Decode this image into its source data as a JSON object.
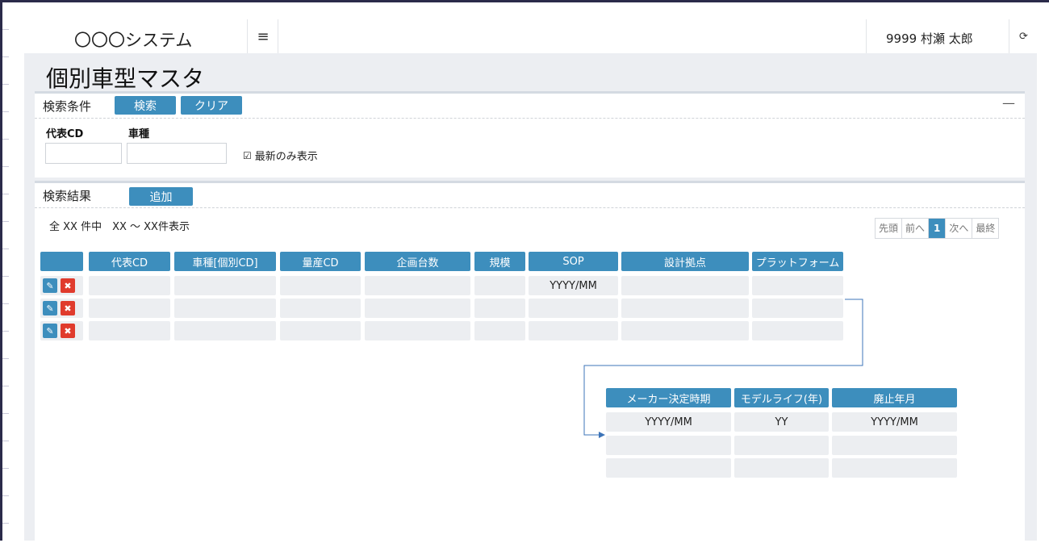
{
  "header": {
    "app_title": "〇〇〇システム",
    "menu_icon": "≡",
    "user_name": "9999 村瀬 太郎",
    "logout_icon": "⟳"
  },
  "page": {
    "title": "個別車型マスタ"
  },
  "search_panel": {
    "label": "検索条件",
    "search_button": "検索",
    "clear_button": "クリア",
    "collapse_icon": "—",
    "field1_label": "代表CD",
    "field1_value": "",
    "field2_label": "車種",
    "field2_value": "",
    "checkbox_icon": "☑",
    "checkbox_label": "最新のみ表示"
  },
  "results_panel": {
    "label": "検索結果",
    "add_button": "追加",
    "count_text": "全 XX 件中　XX ～ XX件表示",
    "pager": {
      "first": "先頭",
      "prev": "前へ",
      "current": "1",
      "next": "次へ",
      "last": "最終"
    },
    "main_table": {
      "headers": [
        "",
        "代表CD",
        "車種[個別CD]",
        "量産CD",
        "企画台数",
        "規模",
        "SOP",
        "設計拠点",
        "プラットフォーム"
      ],
      "rows": [
        [
          "",
          "",
          "",
          "",
          "",
          "YYYY/MM",
          "",
          ""
        ],
        [
          "",
          "",
          "",
          "",
          "",
          "",
          "",
          ""
        ],
        [
          "",
          "",
          "",
          "",
          "",
          "",
          "",
          ""
        ]
      ]
    },
    "ext_table": {
      "headers": [
        "メーカー決定時期",
        "モデルライフ(年)",
        "廃止年月"
      ],
      "rows": [
        [
          "YYYY/MM",
          "YY",
          "YYYY/MM"
        ],
        [
          "",
          "",
          ""
        ],
        [
          "",
          "",
          ""
        ]
      ]
    },
    "edit_icon": "✎",
    "delete_icon": "✖"
  },
  "colors": {
    "accent": "#3d8ebd",
    "danger": "#e03b2d",
    "cell_bg": "#eceef1",
    "page_bg": "#eceef2"
  }
}
